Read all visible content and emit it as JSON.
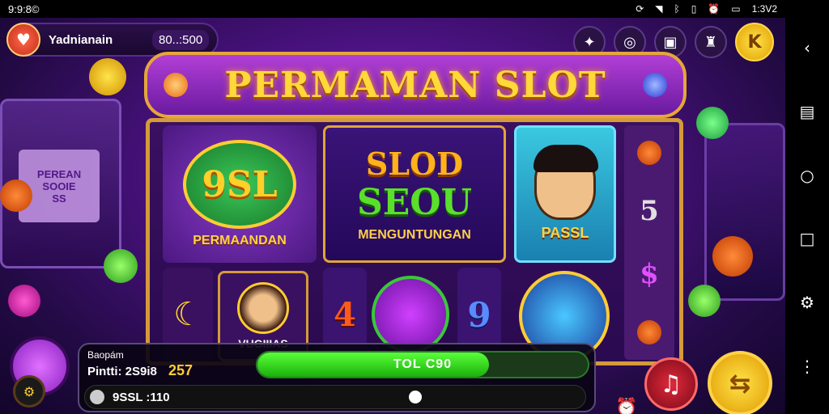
{
  "statusbar": {
    "time": "9:9:8©",
    "right_time": "1:3V2",
    "icons": [
      "sync-icon",
      "wifi-icon",
      "bluetooth-icon",
      "vibrate-icon",
      "alarm-icon",
      "battery-icon"
    ]
  },
  "user": {
    "name": "Yadnianain",
    "balance": "80..:500"
  },
  "banner": {
    "title": "PERMAMAN SLOT"
  },
  "tiles": {
    "logo_text": "9SL",
    "logo_sub": "PERMAANDAN",
    "center_l1": "SLOD",
    "center_l2": "SEOU",
    "center_l3": "MENGUNTUNGAN",
    "avatar_name": "PASSL",
    "small_portrait_caption": "VUGIIIAS",
    "num_left": "4",
    "num_right": "9"
  },
  "reel": [
    "5",
    "$"
  ],
  "machine_screen": "PEREAN\nSOOIE\nSS",
  "bottom": {
    "label_small": "Baopám",
    "label_line": "Pintti: 2S9i8",
    "label_highlight": "257",
    "progress_label": "TOL C90",
    "progress_fraction": 0.7,
    "row2_text": "9SSL :110"
  },
  "colors": {
    "accent_gold": "#ffcc33",
    "progress_green": "#2ad61a",
    "bg_purple": "#4a1280"
  }
}
